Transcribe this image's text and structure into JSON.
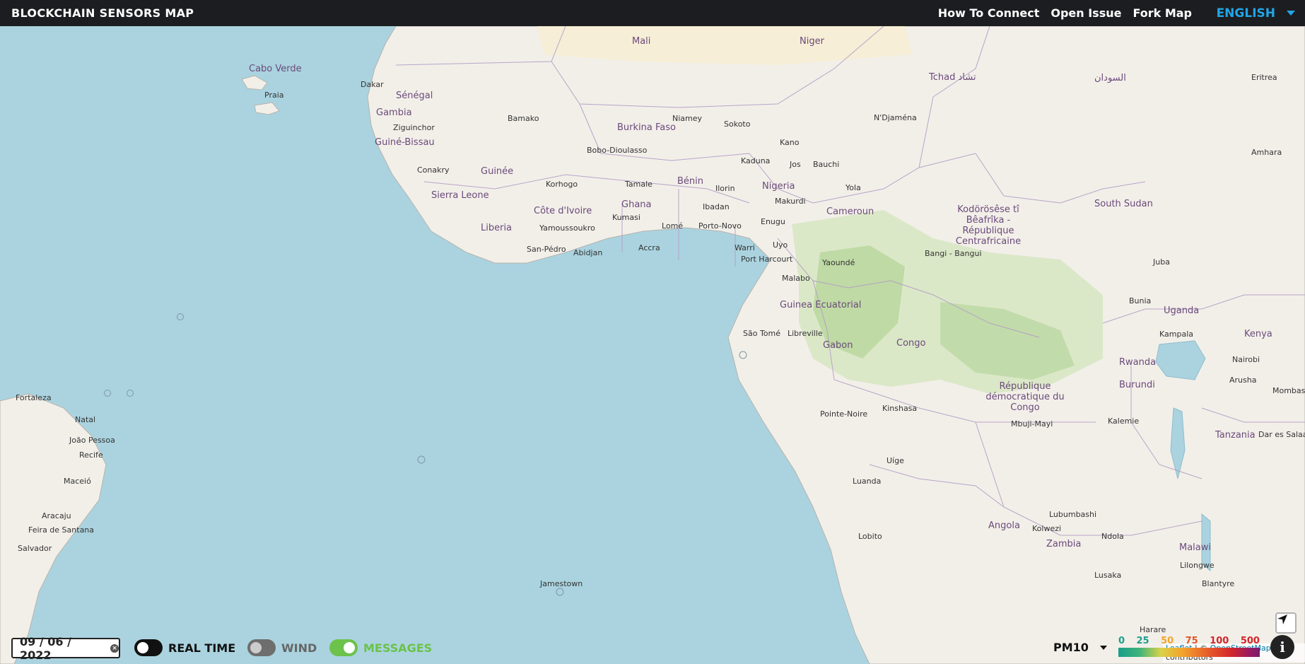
{
  "header": {
    "brand": "BLOCKCHAIN SENSORS MAP",
    "nav": [
      {
        "label": "How To Connect"
      },
      {
        "label": "Open Issue"
      },
      {
        "label": "Fork Map"
      }
    ],
    "language": "ENGLISH"
  },
  "controls": {
    "date": "09 / 06 / 2022",
    "toggles": [
      {
        "label": "REAL TIME",
        "on": false,
        "color": "#111111"
      },
      {
        "label": "WIND",
        "on": false,
        "color": "#666666"
      },
      {
        "label": "MESSAGES",
        "on": true,
        "color": "#6cc24a"
      }
    ],
    "pollutant": "PM10",
    "legend": {
      "ticks": [
        {
          "label": "0",
          "color": "#1a9e8a"
        },
        {
          "label": "25",
          "color": "#1a9e8a"
        },
        {
          "label": "50",
          "color": "#f3a52c"
        },
        {
          "label": "75",
          "color": "#e5562a"
        },
        {
          "label": "100",
          "color": "#d2262a"
        },
        {
          "label": "500",
          "color": "#d2262a"
        }
      ]
    }
  },
  "attribution": {
    "leaflet": "Leaflet",
    "separator": " | © ",
    "osm": "OpenStreetMap",
    "suffix": " contributors"
  },
  "map": {
    "countries": [
      "Mali",
      "Niger",
      "Tchad تشاد",
      "Sénégal",
      "Gambia",
      "Guiné-Bissau",
      "Guinée",
      "Sierra Leone",
      "Liberia",
      "Côte d'Ivoire",
      "Ghana",
      "Bénin",
      "Nigeria",
      "Burkina Faso",
      "Cameroun",
      "Kodörösêse tî Bêafrîka - République Centrafricaine",
      "South Sudan",
      "السودان",
      "Guinea Ecuatorial",
      "Gabon",
      "Congo",
      "République démocratique du Congo",
      "Angola",
      "Zambia",
      "Uganda",
      "Kenya",
      "Rwanda",
      "Burundi",
      "Tanzania",
      "Malawi",
      "Cabo Verde"
    ],
    "cities": [
      "Dakar",
      "Praia",
      "Ziguinchor",
      "Conakry",
      "Bamako",
      "Bobo-Dioulasso",
      "Niamey",
      "Sokoto",
      "Kano",
      "Kaduna",
      "Jos",
      "Bauchi",
      "N'Djaména",
      "Korhogo",
      "Tamale",
      "Ilorin",
      "Ibadan",
      "Makurdi",
      "Yola",
      "Yamoussoukro",
      "Kumasi",
      "Lomé",
      "Porto-Novo",
      "Enugu",
      "Abidjan",
      "Accra",
      "San-Pédro",
      "Warri",
      "Uyo",
      "Port Harcourt",
      "Malabo",
      "Yaoundé",
      "Bangi - Bangui",
      "Juba",
      "São Tomé",
      "Libreville",
      "Bunia",
      "Kampala",
      "Nairobi",
      "Arusha",
      "Kinshasa",
      "Pointe-Noire",
      "Mbuji-Mayi",
      "Kalemie",
      "Uíge",
      "Luanda",
      "Lubumbashi",
      "Kolwezi",
      "Ndola",
      "Lobito",
      "Lusaka",
      "Harare",
      "Lilongwe",
      "Blantyre",
      "Jamestown",
      "Fortaleza",
      "Natal",
      "João Pessoa",
      "Recife",
      "Maceió",
      "Aracaju",
      "Feira de Santana",
      "Salvador",
      "Dar es Salaam",
      "Mombasa",
      "Eritrea",
      "Amhara"
    ]
  }
}
